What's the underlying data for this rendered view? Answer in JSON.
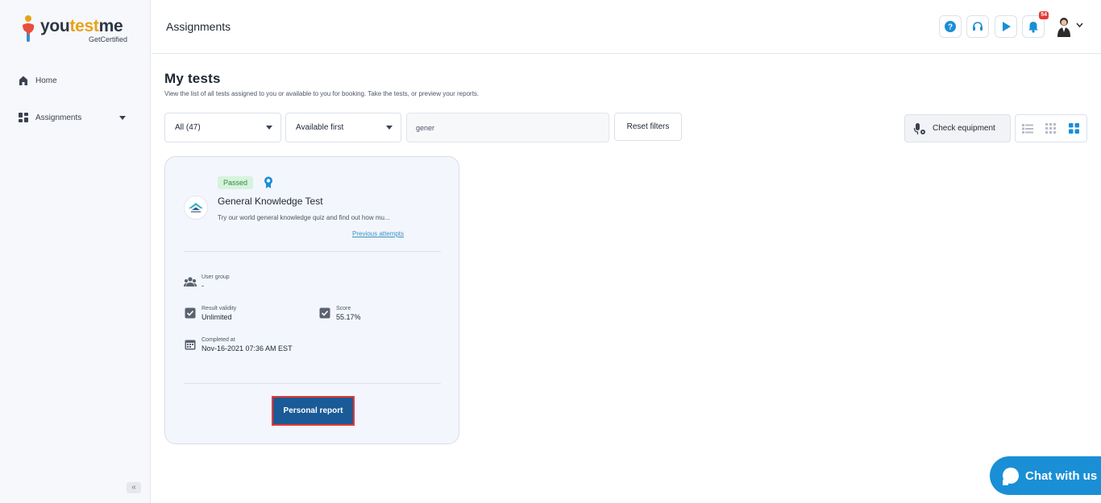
{
  "sidebar": {
    "logo_prefix": "you",
    "logo_accent": "test",
    "logo_suffix": "me",
    "logo_sub": "GetCertified",
    "items": [
      {
        "label": "Home",
        "icon": "home-icon"
      },
      {
        "label": "Assignments",
        "icon": "dashboard-icon"
      }
    ],
    "collapse_label": "«"
  },
  "topbar": {
    "title": "Assignments",
    "notification_count": "54"
  },
  "main": {
    "title": "My tests",
    "subtitle": "View the list of all tests assigned to you or available to you for booking. Take the tests, or preview your reports.",
    "filters": {
      "status": "All (47)",
      "sort": "Available first",
      "search_value": "gener",
      "reset_label": "Reset filters",
      "check_equipment_label": "Check equipment"
    },
    "card": {
      "status": "Passed",
      "name": "General Knowledge Test",
      "description": "Try our world general knowledge quiz and find out how mu...",
      "previous_attempts": "Previous attempts",
      "user_group_label": "User group",
      "user_group_value": "-",
      "validity_label": "Result validity",
      "validity_value": "Unlimited",
      "score_label": "Score",
      "score_value": "55.17%",
      "completed_label": "Completed at",
      "completed_value": "Nov-16-2021 07:36 AM EST",
      "report_button": "Personal report"
    }
  },
  "chat": {
    "label": "Chat with us"
  },
  "colors": {
    "primary": "#1a5a96",
    "chat": "#1a8fd6",
    "passed_bg": "#d7f3dc",
    "passed_text": "#2e8b44",
    "highlight_border": "#e53935"
  }
}
